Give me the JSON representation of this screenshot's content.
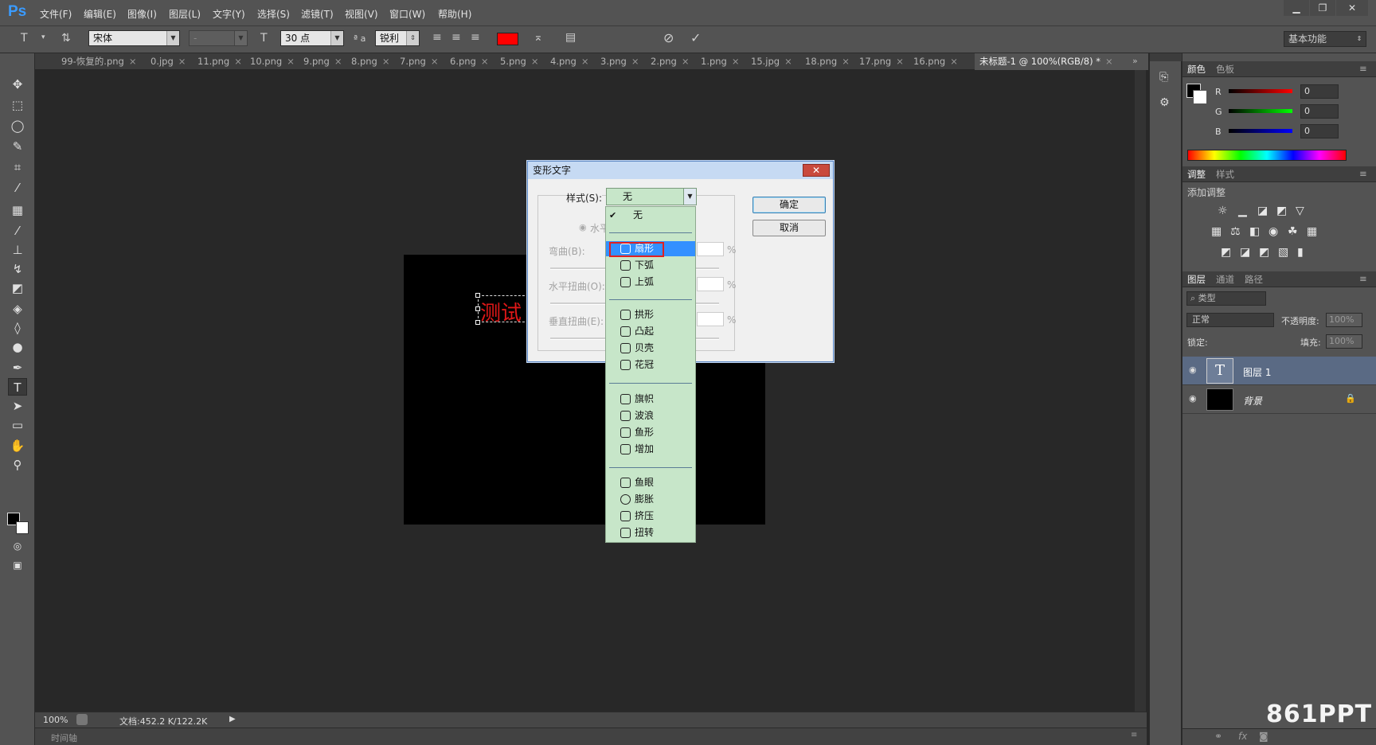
{
  "app": {
    "logo": "Ps"
  },
  "menubar": {
    "items": [
      "文件(F)",
      "编辑(E)",
      "图像(I)",
      "图层(L)",
      "文字(Y)",
      "选择(S)",
      "滤镜(T)",
      "视图(V)",
      "窗口(W)",
      "帮助(H)"
    ],
    "window_controls": [
      "minimize-icon",
      "restore-icon",
      "close-icon"
    ]
  },
  "options_bar": {
    "font_family": "宋体",
    "font_style": "-",
    "font_size": "30 点",
    "aa_label": "ª a",
    "antialias": "锐利",
    "text_color": "#ff0000",
    "workspace": "基本功能"
  },
  "tabs": [
    {
      "label": "99-恢复的.png"
    },
    {
      "label": "0.jpg"
    },
    {
      "label": "11.png"
    },
    {
      "label": "10.png"
    },
    {
      "label": "9.png"
    },
    {
      "label": "8.png"
    },
    {
      "label": "7.png"
    },
    {
      "label": "6.png"
    },
    {
      "label": "5.png"
    },
    {
      "label": "4.png"
    },
    {
      "label": "3.png"
    },
    {
      "label": "2.png"
    },
    {
      "label": "1.png"
    },
    {
      "label": "15.jpg"
    },
    {
      "label": "18.png"
    },
    {
      "label": "17.png"
    },
    {
      "label": "16.png"
    },
    {
      "label": "未标题-1 @ 100%(RGB/8) *"
    }
  ],
  "canvas": {
    "text": "测试"
  },
  "status": {
    "zoom": "100%",
    "doc": "文档:452.2 K/122.2K",
    "timeline": "时间轴"
  },
  "color_panel": {
    "tabs": [
      "颜色",
      "色板"
    ],
    "rows": [
      {
        "label": "R",
        "value": "0"
      },
      {
        "label": "G",
        "value": "0"
      },
      {
        "label": "B",
        "value": "0"
      }
    ]
  },
  "adjust_panel": {
    "tabs": [
      "调整",
      "样式"
    ],
    "title": "添加调整"
  },
  "layers_panel": {
    "tabs": [
      "图层",
      "通道",
      "路径"
    ],
    "filter": "类型",
    "blend": "正常",
    "opacity_label": "不透明度:",
    "opacity": "100%",
    "lock_label": "锁定:",
    "fill_label": "填充:",
    "fill": "100%",
    "layers": [
      {
        "name": "图层 1",
        "thumb": "T"
      },
      {
        "name": "背景",
        "thumb": ""
      }
    ]
  },
  "dialog": {
    "title": "变形文字",
    "style_label": "样式(S):",
    "style_value": "无",
    "horiz_label": "水平",
    "bend_label": "弯曲(B):",
    "hdist_label": "水平扭曲(O):",
    "vdist_label": "垂直扭曲(E):",
    "percent": "%",
    "ok": "确定",
    "cancel": "取消"
  },
  "dropdown": {
    "checked": "无",
    "groups": [
      [
        "扇形",
        "下弧",
        "上弧"
      ],
      [
        "拱形",
        "凸起",
        "贝壳",
        "花冠"
      ],
      [
        "旗帜",
        "波浪",
        "鱼形",
        "增加"
      ],
      [
        "鱼眼",
        "膨胀",
        "挤压",
        "扭转"
      ]
    ],
    "highlight": "扇形",
    "highlight_color": "#3390ff",
    "annotation_color": "#e02020"
  },
  "watermark": {
    "text": "861PPT"
  }
}
